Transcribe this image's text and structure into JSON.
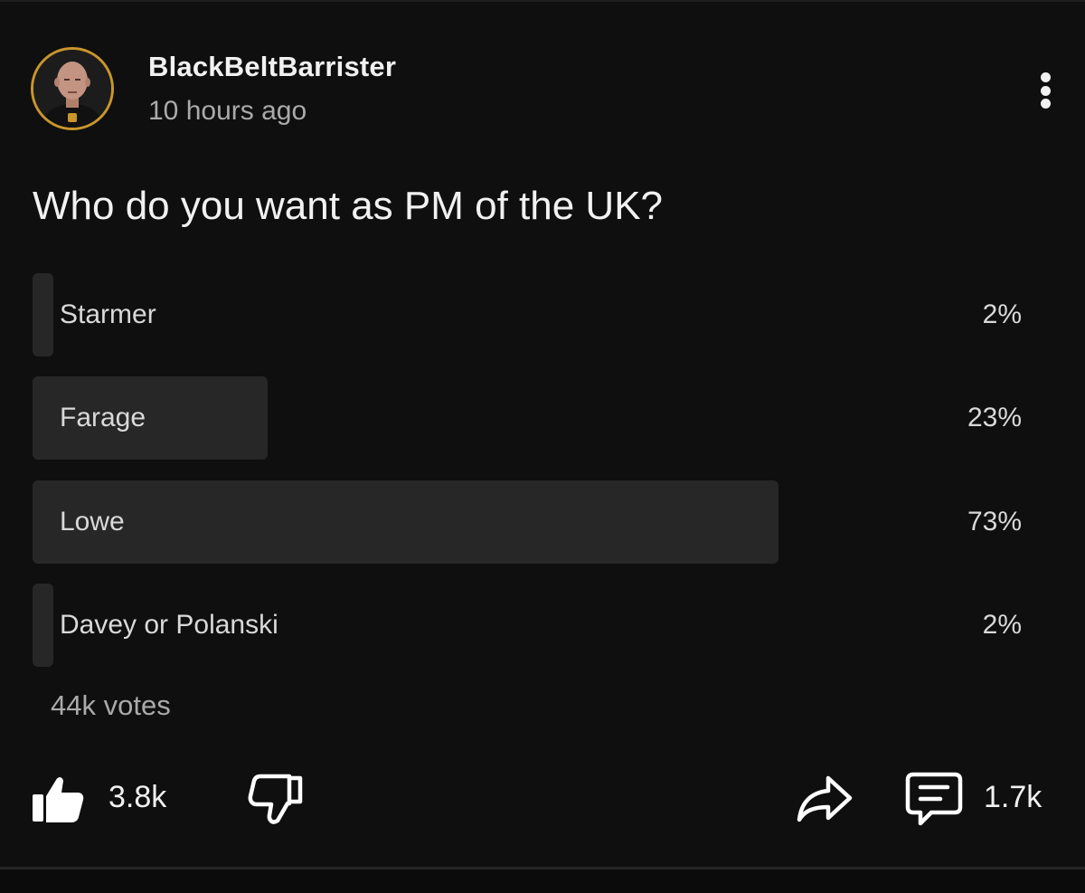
{
  "channel": {
    "name": "BlackBeltBarrister",
    "time": "10 hours ago"
  },
  "poll": {
    "question": "Who do you want as PM of the UK?",
    "options": [
      {
        "label": "Starmer",
        "percent": "2%",
        "share": 2
      },
      {
        "label": "Farage",
        "percent": "23%",
        "share": 23
      },
      {
        "label": "Lowe",
        "percent": "73%",
        "share": 73
      },
      {
        "label": "Davey or Polanski",
        "percent": "2%",
        "share": 2
      }
    ],
    "votes": "44k votes"
  },
  "actions": {
    "likes": "3.8k",
    "comments": "1.7k",
    "icons": [
      "thumbs-up-icon",
      "thumbs-down-icon",
      "share-icon",
      "comment-icon",
      "more-vert-icon"
    ]
  },
  "colors": {
    "background": "#0f0f0f",
    "bar": "#272727",
    "avatar_ring": "#c9962b",
    "secondary_text": "#aaaaaa"
  }
}
